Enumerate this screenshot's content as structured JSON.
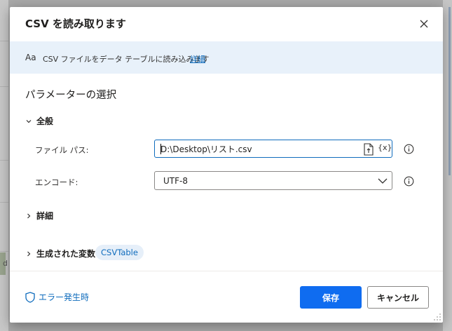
{
  "dialog": {
    "title": "CSV を読み取ります",
    "info": {
      "icon_text": "Aa",
      "description": "CSV ファイルをデータ テーブルに読み込みます",
      "details_link": "詳細"
    },
    "section_title": "パラメーターの選択",
    "general": {
      "label": "全般",
      "file_path": {
        "label": "ファイル パス:",
        "value": "D:\\Desktop\\リスト.csv",
        "variable_button": "{x}"
      },
      "encoding": {
        "label": "エンコード:",
        "selected": "UTF-8"
      }
    },
    "advanced": {
      "label": "詳細"
    },
    "generated_vars": {
      "label": "生成された変数",
      "badge": "CSVTable"
    },
    "footer": {
      "on_error": "エラー発生時",
      "save": "保存",
      "cancel": "キャンセル"
    }
  },
  "background": {
    "left_fragment_text": "d"
  },
  "colors": {
    "accent": "#0f6cbd",
    "primary_button": "#0f6cf0",
    "info_bar": "#e8f1fa",
    "overlay": "#a9a9a9"
  },
  "icons": [
    "close-icon",
    "font-icon",
    "chevron-down-icon",
    "chevron-right-icon",
    "file-icon",
    "info-icon",
    "shield-icon",
    "resize-grip-icon"
  ]
}
